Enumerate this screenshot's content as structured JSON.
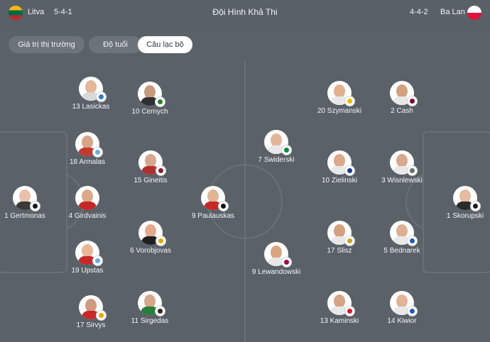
{
  "header": {
    "home_team": "Litva",
    "home_formation": "5-4-1",
    "title": "Đội Hình Khả Thi",
    "away_formation": "4-4-2",
    "away_team": "Ba Lan"
  },
  "tabs": [
    {
      "label": "Giá trị thị trường",
      "active": false
    },
    {
      "label": "Độ tuổi",
      "active": false
    },
    {
      "label": "Câu lạc bộ",
      "active": true
    }
  ],
  "players": [
    {
      "label": "13 Lasickas",
      "club_color": "#2e7bc4"
    },
    {
      "label": "10 Cernych",
      "club_color": "#2e7d32"
    },
    {
      "label": "18 Armalas",
      "club_color": "#6cabdd"
    },
    {
      "label": "15 Gineitis",
      "club_color": "#8b1e2d"
    },
    {
      "label": "1 Gertmonas",
      "club_color": "#1a1a1a"
    },
    {
      "label": "4 Girdvainis",
      "club_color": "#c62828"
    },
    {
      "label": "9 Paulauskas",
      "club_color": "#111111"
    },
    {
      "label": "6 Vorobjovas",
      "club_color": "#e0a800"
    },
    {
      "label": "19 Upstas",
      "club_color": "#6cabdd"
    },
    {
      "label": "17 Sirvys",
      "club_color": "#f0a500"
    },
    {
      "label": "11 Sirgedas",
      "club_color": "#2b2b2b"
    },
    {
      "label": "20 Szymanski",
      "club_color": "#f2b705"
    },
    {
      "label": "2 Cash",
      "club_color": "#7a003c"
    },
    {
      "label": "7 Swiderski",
      "club_color": "#0a8a3a"
    },
    {
      "label": "10 Zielinski",
      "club_color": "#1e3a8a"
    },
    {
      "label": "3 Wisnlewski",
      "club_color": "#6b6b6b"
    },
    {
      "label": "1 Skorupski",
      "club_color": "#1a1a1a"
    },
    {
      "label": "9 Lewandowski",
      "club_color": "#a50044"
    },
    {
      "label": "17 Slisz",
      "club_color": "#c9a227"
    },
    {
      "label": "5 Bednarek",
      "club_color": "#1e5bb8"
    },
    {
      "label": "13 Kaminski",
      "club_color": "#d7192d"
    },
    {
      "label": "14 Kiwior",
      "club_color": "#1e5bb8"
    }
  ]
}
